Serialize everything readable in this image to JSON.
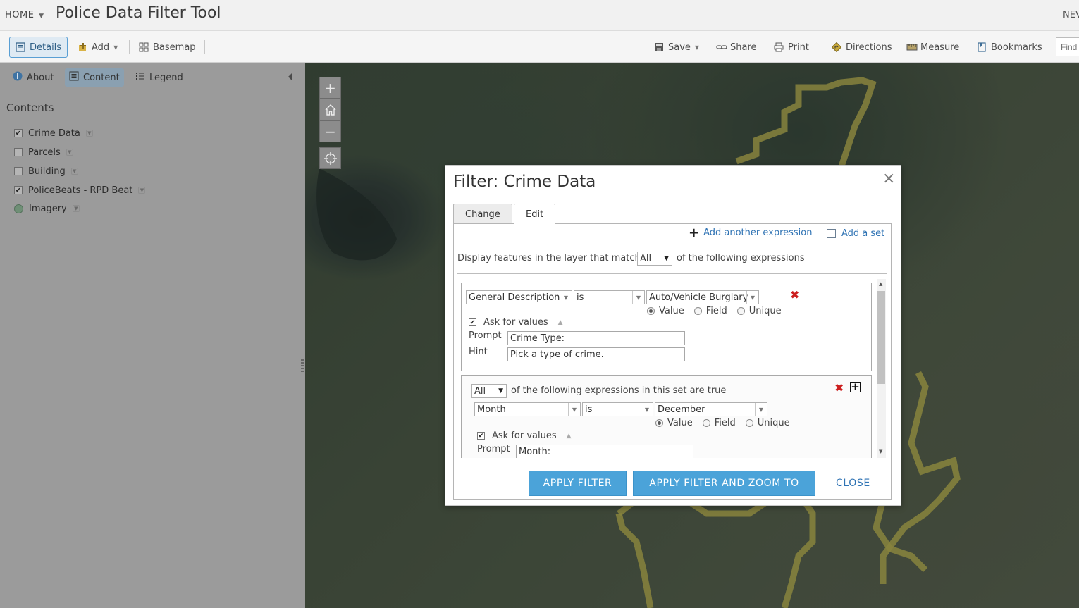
{
  "header": {
    "home_label": "HOME",
    "title": "Police Data Filter Tool",
    "right_text": "NEV"
  },
  "toolbar": {
    "details": "Details",
    "add": "Add",
    "basemap": "Basemap",
    "save": "Save",
    "share": "Share",
    "print": "Print",
    "directions": "Directions",
    "measure": "Measure",
    "bookmarks": "Bookmarks",
    "find_placeholder": "Find"
  },
  "left_panel": {
    "tabs": {
      "about": "About",
      "content": "Content",
      "legend": "Legend"
    },
    "contents_title": "Contents",
    "layers": [
      {
        "name": "Crime Data",
        "checked": true
      },
      {
        "name": "Parcels",
        "checked": false
      },
      {
        "name": "Building",
        "checked": false
      },
      {
        "name": "PoliceBeats - RPD Beat",
        "checked": true
      },
      {
        "name": "Imagery",
        "checked": false
      }
    ]
  },
  "map": {
    "zoom_in": "+",
    "zoom_out": "−",
    "outline_color": "#c8c25a"
  },
  "modal": {
    "title": "Filter: Crime Data",
    "close": "×",
    "tabs": {
      "change": "Change",
      "edit": "Edit"
    },
    "add_expression": "Add another expression",
    "add_set": "Add a set",
    "match_prefix": "Display features in the layer that match",
    "match_value": "All",
    "match_suffix": "of the following expressions",
    "expr1": {
      "field": "General Description",
      "operator": "is",
      "value": "Auto/Vehicle Burglary",
      "radio_value": "Value",
      "radio_field": "Field",
      "radio_unique": "Unique",
      "ask_label": "Ask for values",
      "prompt_label": "Prompt",
      "prompt_value": "Crime Type:",
      "hint_label": "Hint",
      "hint_value": "Pick a type of crime."
    },
    "set": {
      "match_value": "All",
      "match_suffix": "of the following expressions in this set are true",
      "field": "Month",
      "operator": "is",
      "value": "December",
      "radio_value": "Value",
      "radio_field": "Field",
      "radio_unique": "Unique",
      "ask_label": "Ask for values",
      "prompt_label": "Prompt",
      "prompt_value": "Month:"
    },
    "buttons": {
      "apply": "APPLY FILTER",
      "apply_zoom": "APPLY FILTER AND ZOOM TO",
      "close": "CLOSE"
    },
    "accent_color": "#4ba3d9"
  }
}
